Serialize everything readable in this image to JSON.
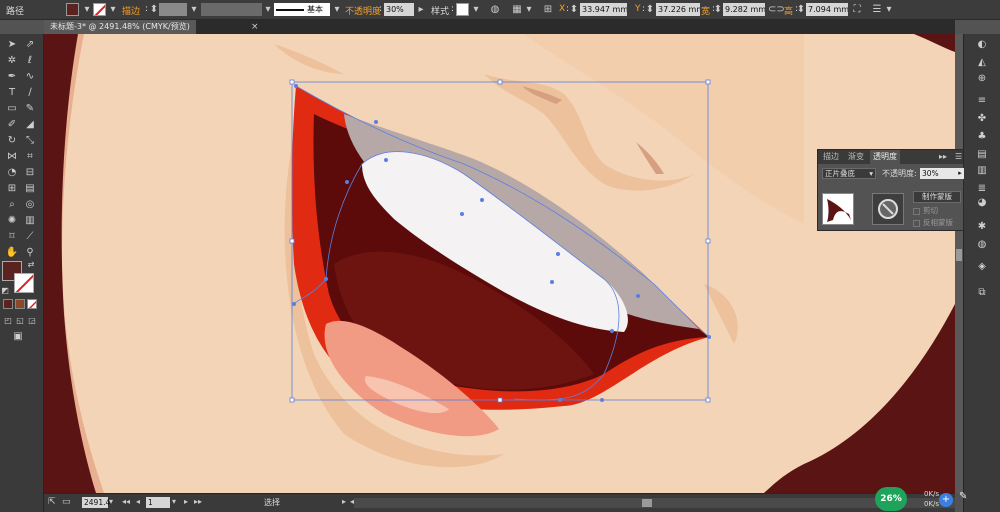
{
  "control_bar": {
    "object_type": "路径",
    "stroke_label": "描边",
    "stroke_value": "",
    "brush_label": "基本",
    "opacity_label": "不透明度",
    "opacity_value": "30%",
    "style_label": "样式",
    "x_label": "X",
    "x_value": "33.947 mm",
    "y_label": "Y",
    "y_value": "37.226 mm",
    "w_label": "宽",
    "w_value": "9.282 mm",
    "h_label": "高",
    "h_value": "7.094 mm",
    "fill_color": "#5a2320",
    "accent_color": "#f0a030"
  },
  "document": {
    "tab_title": "未标题-3* @ 2491.48% (CMYK/预览)",
    "close_glyph": "×"
  },
  "transparency_panel": {
    "tabs": [
      "描边",
      "渐变",
      "透明度"
    ],
    "active_tab": "透明度",
    "blend_mode": "正片叠底",
    "opacity_label": "不透明度",
    "opacity_value": "30%",
    "make_mask_label": "制作蒙版",
    "clip_label": "剪切",
    "invert_label": "反相蒙版"
  },
  "status_bar": {
    "zoom_value": "2491.4",
    "page_value": "1",
    "status_text": "选择"
  },
  "tools": {
    "fill_color": "#5a2320",
    "stroke_color": "#ffffff"
  },
  "net_widget": {
    "percent": "26%",
    "up_rate": "0K/s",
    "down_rate": "0K/s",
    "plus_glyph": "+"
  }
}
